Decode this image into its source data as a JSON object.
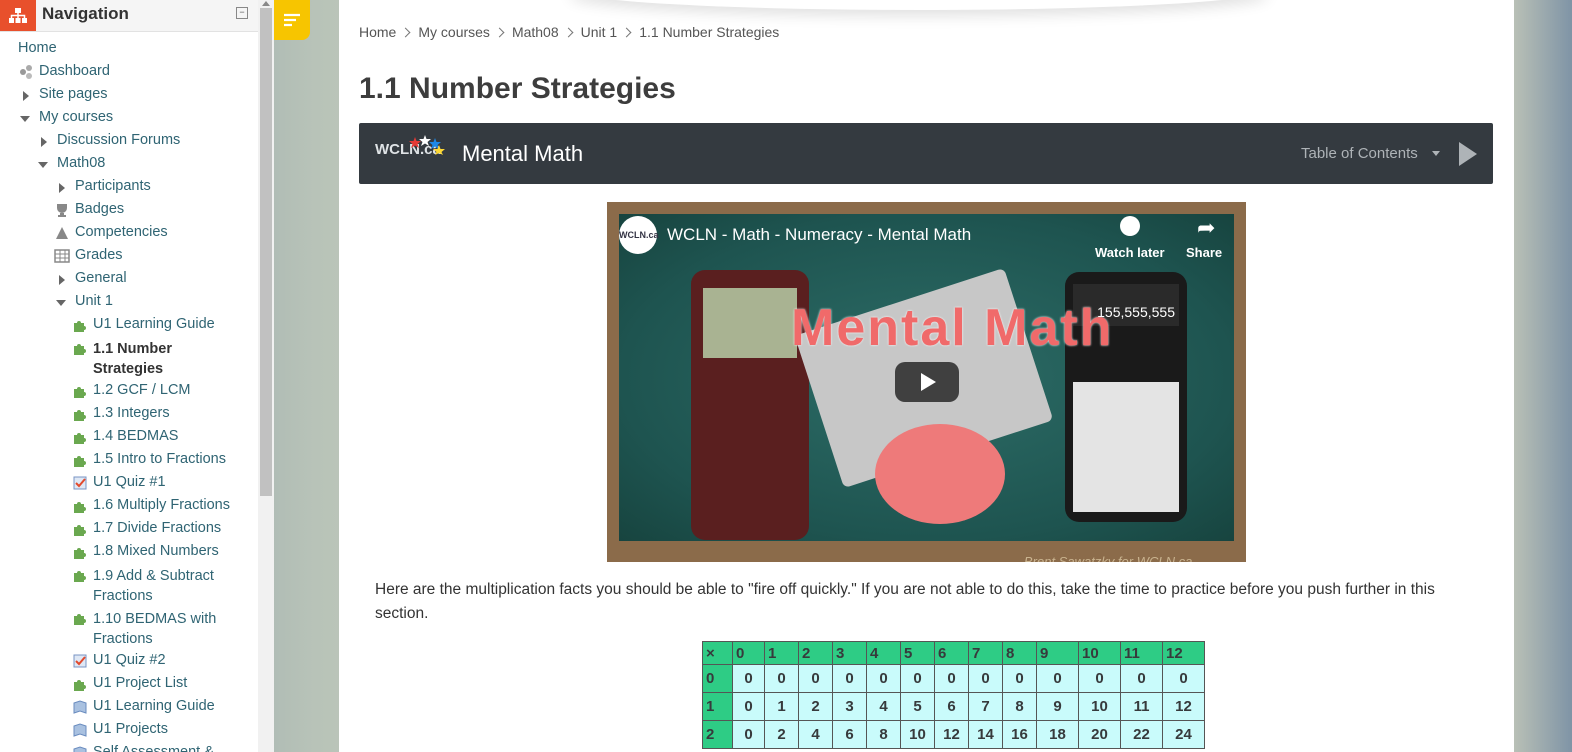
{
  "nav": {
    "title": "Navigation",
    "collapse": "−",
    "items": [
      {
        "label": "Home"
      },
      {
        "label": "Dashboard"
      },
      {
        "label": "Site pages"
      },
      {
        "label": "My courses"
      },
      {
        "label": "Discussion Forums"
      },
      {
        "label": "Math08"
      },
      {
        "label": "Participants"
      },
      {
        "label": "Badges"
      },
      {
        "label": "Competencies"
      },
      {
        "label": "Grades"
      },
      {
        "label": "General"
      },
      {
        "label": "Unit 1"
      },
      {
        "label": "U1 Learning Guide"
      },
      {
        "label": "1.1 Number Strategies"
      },
      {
        "label": "1.2 GCF / LCM"
      },
      {
        "label": "1.3 Integers"
      },
      {
        "label": "1.4 BEDMAS"
      },
      {
        "label": "1.5 Intro to Fractions"
      },
      {
        "label": "U1 Quiz #1"
      },
      {
        "label": "1.6 Multiply Fractions"
      },
      {
        "label": "1.7 Divide Fractions"
      },
      {
        "label": "1.8 Mixed Numbers"
      },
      {
        "label": "1.9 Add & Subtract Fractions"
      },
      {
        "label": "1.10 BEDMAS with Fractions"
      },
      {
        "label": "U1 Quiz #2"
      },
      {
        "label": "U1 Project List"
      },
      {
        "label": "U1 Learning Guide"
      },
      {
        "label": "U1 Projects"
      },
      {
        "label": "Self Assessment &"
      }
    ]
  },
  "breadcrumb": [
    "Home",
    "My courses",
    "Math08",
    "Unit 1",
    "1.1 Number Strategies"
  ],
  "page_title": "1.1 Number Strategies",
  "h5p": {
    "logo": "WCLN.ca",
    "title": "Mental Math",
    "toc": "Table of Contents"
  },
  "video": {
    "channel_logo": "WCLN.ca",
    "title": "WCLN - Math - Numeracy - Mental Math",
    "watch_later": "Watch later",
    "share": "Share",
    "overlay": "Mental Math",
    "credit": "Brent Sawatzky for WCLN.ca",
    "calc_display": "155,555,555"
  },
  "intro_text": "Here are the multiplication facts you should be able to \"fire off quickly.\"   If you are not able to do this, take the time to practice before you push further in this section.",
  "table": {
    "header": [
      "×",
      "0",
      "1",
      "2",
      "3",
      "4",
      "5",
      "6",
      "7",
      "8",
      "9",
      "10",
      "11",
      "12"
    ],
    "rows": [
      {
        "label": "0",
        "values": [
          "0",
          "0",
          "0",
          "0",
          "0",
          "0",
          "0",
          "0",
          "0",
          "0",
          "0",
          "0",
          "0"
        ]
      },
      {
        "label": "1",
        "values": [
          "0",
          "1",
          "2",
          "3",
          "4",
          "5",
          "6",
          "7",
          "8",
          "9",
          "10",
          "11",
          "12"
        ]
      },
      {
        "label": "2",
        "values": [
          "0",
          "2",
          "4",
          "6",
          "8",
          "10",
          "12",
          "14",
          "16",
          "18",
          "20",
          "22",
          "24"
        ]
      }
    ]
  },
  "colors": {
    "accent": "#f7c500",
    "header_bar": "#343a40",
    "table_header": "#2ecc85",
    "table_cell": "#c9fbfb"
  }
}
